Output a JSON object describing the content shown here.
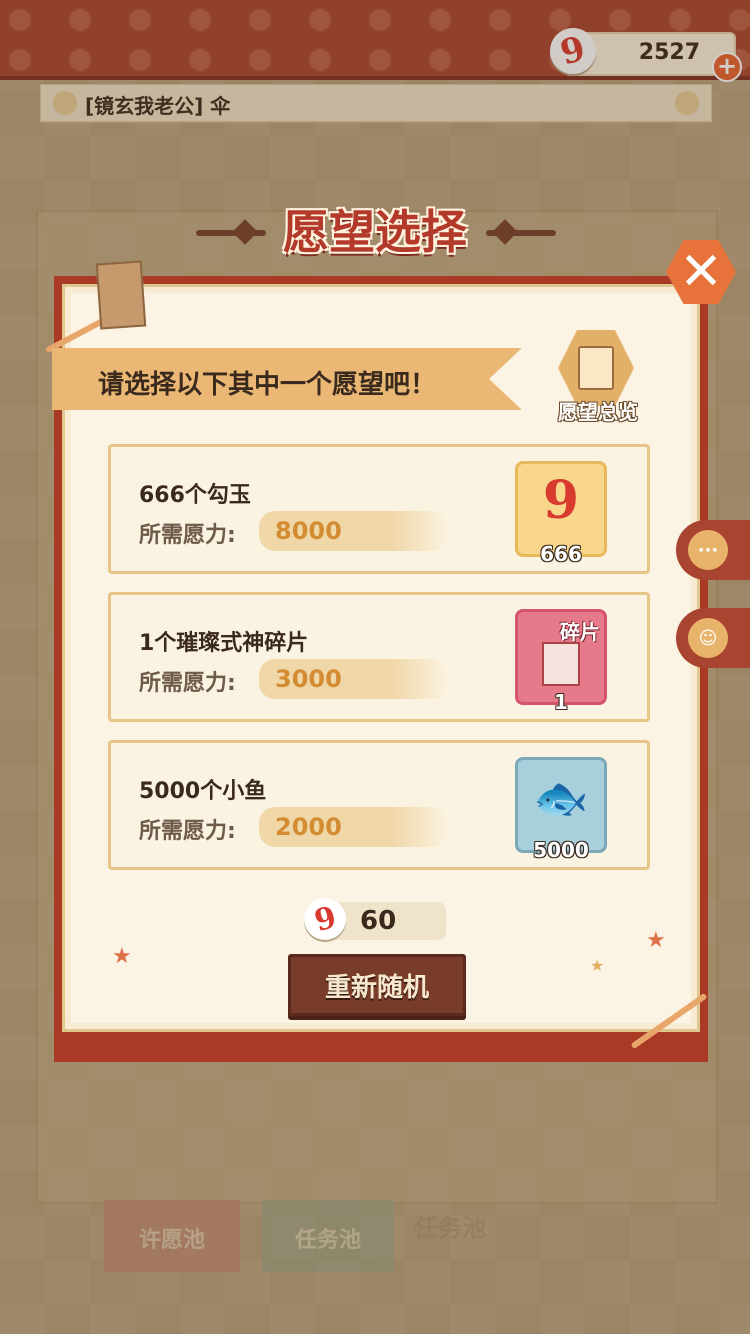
{
  "currency": {
    "value": "2527",
    "icon": "magatama-icon",
    "plus": "+"
  },
  "player": {
    "name": "[镜玄我老公] 伞"
  },
  "dialog": {
    "title": "愿望选择",
    "prompt": "请选择以下其中一个愿望吧！",
    "overview_label": "愿望总览",
    "close": "✕"
  },
  "wishes": [
    {
      "name": "666个勾玉",
      "cost_label": "所需愿力:",
      "cost": "8000",
      "reward_icon": "magatama-icon",
      "reward_glyph": "9",
      "reward_count": "666"
    },
    {
      "name": "1个璀璨式神碎片",
      "cost_label": "所需愿力:",
      "cost": "3000",
      "reward_icon": "shikigami-shard-icon",
      "reward_tag": "碎片",
      "reward_count": "1"
    },
    {
      "name": "5000个小鱼",
      "cost_label": "所需愿力:",
      "cost": "2000",
      "reward_icon": "fish-icon",
      "reward_glyph": "🐟",
      "reward_count": "5000"
    }
  ],
  "reroll": {
    "cost": "60",
    "label": "重新随机"
  },
  "background": {
    "tab_wish_pool": "许愿池",
    "tab_task_pool": "任务池",
    "tab_task_pool_faded": "任务池"
  }
}
